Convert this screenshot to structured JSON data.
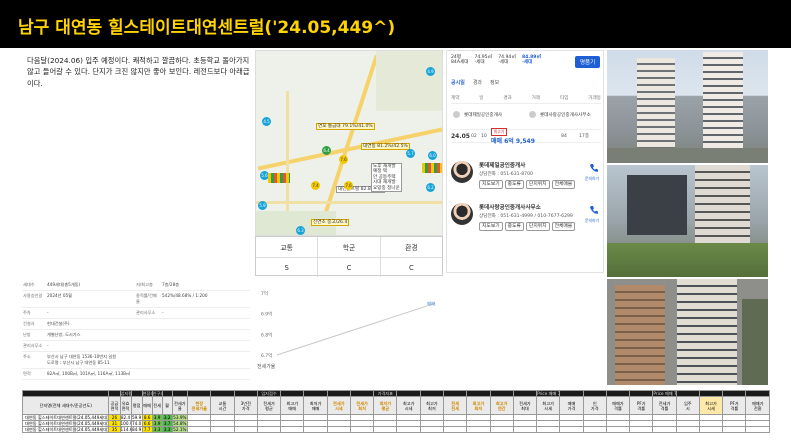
{
  "title": "남구 대연동 힐스테이트대연센트럴('24.05,449^)",
  "description": "다음달(2024.06) 입주 예정이다. 쾌적하고 깔끔하다. 초등학교 돌아가지 않고 들어갈 수 있다. 단지가 크진 않지만 좋아 보인다. 레전드보다 아래급이다.",
  "map": {
    "labels": [
      "연포 통금대\n79.1%/41.0%",
      "대연동\n81.2%/42.5%",
      "대연센트럴\n82.8/41.5",
      "신연초\n중고/26.4",
      "노후 재개발\n예정 택\n안 공동주택\n시대 재개발\n요망중 정나운"
    ],
    "pins": [
      "4.5",
      "5.6",
      "7.4",
      "6.4",
      "6.3",
      "7.6",
      "4.9",
      "5.9",
      "5.7",
      "6.0",
      "7.6",
      "6.2"
    ]
  },
  "scores": {
    "headers": [
      "교통",
      "학군",
      "환경"
    ],
    "values": [
      "S",
      "C",
      "C"
    ]
  },
  "price_panel": {
    "tabs": [
      "24평\n84A세대",
      "74.95㎡\n-세대",
      "74.94㎡\n-세대",
      "84.89㎡\n-세대"
    ],
    "button": "명품기",
    "filters": [
      "공시일",
      "경과",
      "정보"
    ],
    "columns": [
      "계약",
      "일",
      "경과",
      "거래",
      "타입",
      "거래동"
    ],
    "row": {
      "date": "24.05",
      "d1": "02",
      "d2": "10",
      "tag": "최고가",
      "price": "매매 6억 9,549",
      "type": "84",
      "dong": "17층"
    },
    "agents": [
      {
        "name": "롯데제일공인중개사",
        "tel": "상담전화 : 051-631-8700",
        "chips": [
          "지도보기",
          "중도류",
          "단지위치",
          "전체매물"
        ],
        "call": "문의하기"
      },
      {
        "name": "롯데사랑공인중개사사무소",
        "tel": "상담전화 : 051-631-4999 / 010-7677-6299",
        "chips": [
          "지도보기",
          "중도류",
          "단지위치",
          "전체매물"
        ],
        "call": "문의하기"
      }
    ]
  },
  "info_table": [
    {
      "k": "세대수",
      "v": "449세대(총5개동)",
      "k2": "저/최고층",
      "v2": "7층/28층"
    },
    {
      "k": "사용승인일",
      "v": "2024년 05월",
      "k2": "용적률/건폐율",
      "v2": "542%/48.68% / 1:200"
    },
    {
      "k": "주차",
      "v": "-",
      "k2": "관리사무소",
      "v2": "-"
    },
    {
      "k": "건설사",
      "v": "현대건설(주)",
      "k2": "",
      "v2": ""
    },
    {
      "k": "난방",
      "v": "개별난방, 도시가스",
      "k2": "",
      "v2": ""
    },
    {
      "k": "관리사무소",
      "v": "-",
      "k2": "",
      "v2": ""
    },
    {
      "k": "주소",
      "v": "부산시 남구 대연동 1536-10번지 일원\n도로명 : 부산시 남구 대연동 85-11",
      "k2": "",
      "v2": ""
    },
    {
      "k": "면적",
      "v": "82A㎡, 100B㎡, 101A㎡, 116A㎡, 113B㎡",
      "k2": "",
      "v2": ""
    }
  ],
  "chart_data": {
    "type": "line",
    "ylabel": "",
    "yticks": [
      "7억",
      "6.9억",
      "6.8억",
      "6.7억"
    ],
    "ylim": [
      6.7,
      7.0
    ],
    "series": [
      {
        "name": "매매",
        "x": [
          0,
          1
        ],
        "values": [
          6.7,
          6.95
        ]
      }
    ],
    "legend": "전세가율",
    "legend_position": "bottom-left"
  },
  "bottom_table": {
    "groups": [
      "",
      "",
      "입지평가",
      "",
      "현장조사",
      "인구가생산성/수요",
      "",
      "",
      "",
      "",
      "",
      "입지점수",
      "",
      "",
      "",
      "",
      "가격지표",
      "",
      "",
      "",
      "",
      "",
      "",
      "Price 매매 7%",
      "",
      "",
      "",
      "",
      "Price 매매 7%",
      "",
      "",
      "",
      ""
    ],
    "headers": [
      "단지명(전체 세대수/준공년도)",
      "공급면적",
      "유효면적",
      "평점",
      "매매",
      "전세",
      "월",
      "전세가율",
      "현장\n전세가율",
      "교통\n시간",
      "3년전\n가격",
      "전세가\n평균",
      "최고가\n매매",
      "최저가\n매매",
      "전세가\n시세",
      "전세가\n최저",
      "최저가\n평균",
      "최고가\n시세",
      "최고가\n최저",
      "전세\n전세",
      "최고가\n최저",
      "최고가\n연간",
      "전세가\n최대",
      "최고가\n시세",
      "매매\n가격",
      "인\n가격",
      "매매가\n격률",
      "PF가\n격률",
      "전세가\n격률",
      "입주\n시",
      "최고가\n시세",
      "PF가\n격률",
      "매매가\n전환"
    ],
    "header_styles": [
      "",
      "",
      "",
      "",
      "",
      "",
      "",
      "",
      "y",
      "",
      "",
      "",
      "",
      "",
      "y",
      "y",
      "y",
      "",
      "",
      "y",
      "y",
      "y",
      "",
      "",
      "",
      "",
      "",
      "",
      "",
      "",
      "o",
      "",
      ""
    ],
    "rows": [
      {
        "name": "대연동 힐스테이트대연센트럴(24.05,449세대)",
        "area": "26",
        "a2": "82.4",
        "score": "59.9",
        "m1": "8.6",
        "m2": "3.9",
        "m3": "3.2",
        "rate": "53.9%"
      },
      {
        "name": "대연동 힐스테이트대연센트럴(24.05,449세대)",
        "area": "31",
        "a2": "100.9",
        "score": "74.0",
        "m1": "6.6",
        "m2": "3.9",
        "m3": "3.7",
        "rate": "54.8%"
      },
      {
        "name": "대연동 힐스테이트대연센트럴(24.05,449세대)",
        "area": "35",
        "a2": "114.6",
        "score": "84.9",
        "m1": "7.7",
        "m2": "3.3",
        "m3": "3.3",
        "rate": "52.1%"
      }
    ]
  },
  "colors": {
    "title_bg": "#000000",
    "title_fg": "#ffd400",
    "accent": "#1f5fd6",
    "pin": "#17a2d8"
  }
}
